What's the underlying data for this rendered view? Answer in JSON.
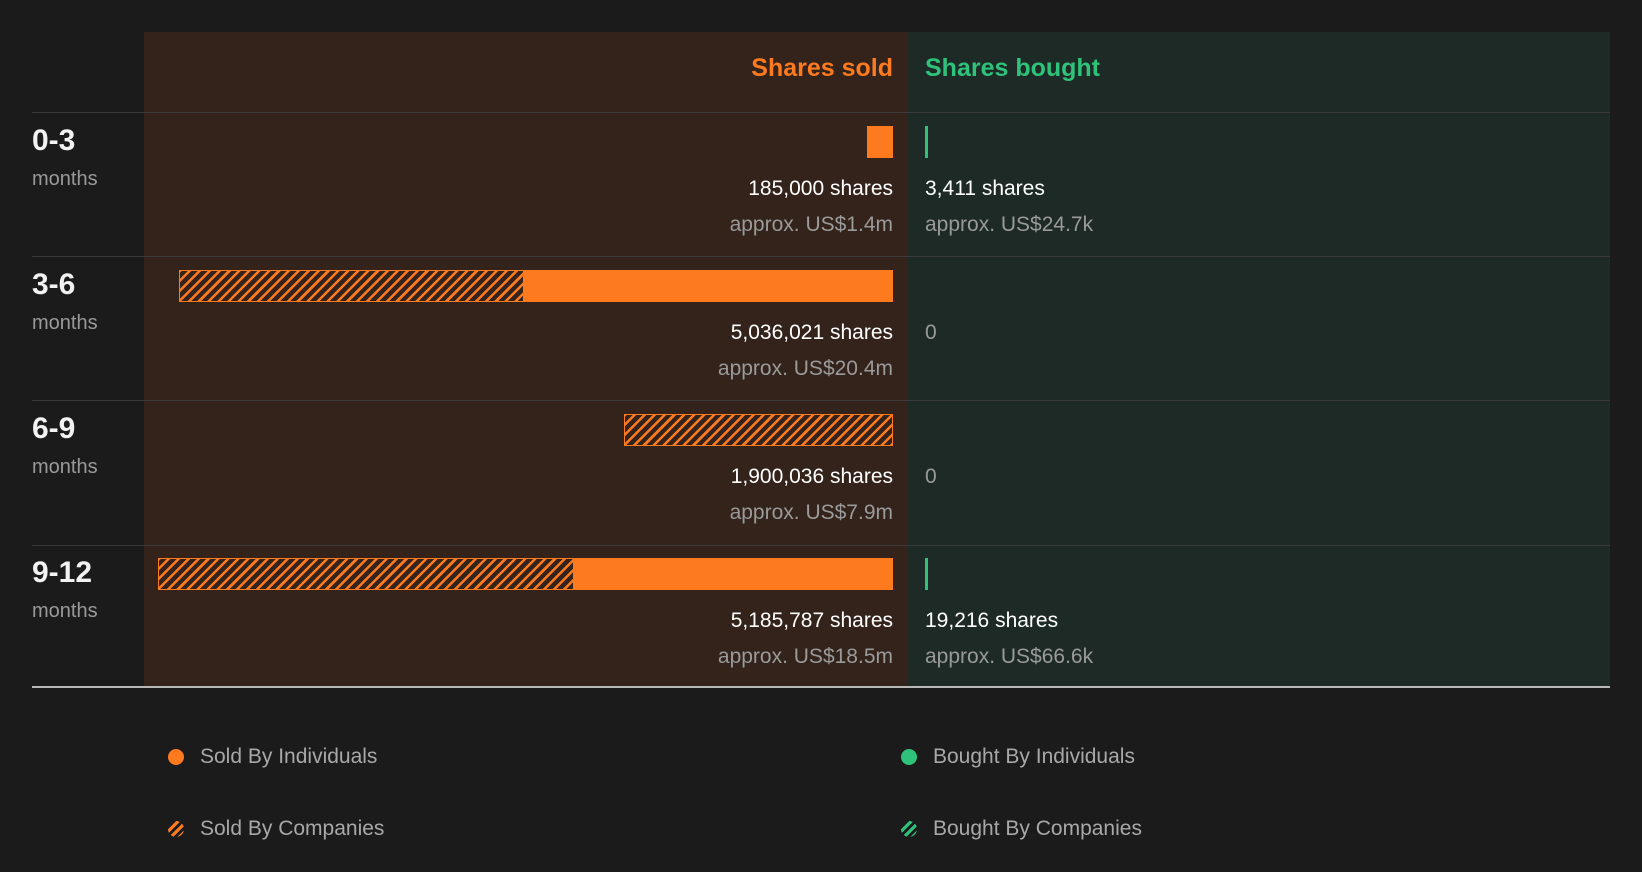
{
  "header": {
    "sold": "Shares sold",
    "bought": "Shares bought"
  },
  "colors": {
    "sold": "#fd7a1f",
    "bought": "#2fc27a",
    "sold_panel": "#33231b",
    "bought_panel": "#1d2a25",
    "background": "#1b1b1b"
  },
  "rows": [
    {
      "range": "0-3",
      "unit": "months",
      "sold_shares": "185,000 shares",
      "sold_approx": "approx. US$1.4m",
      "bought_shares": "3,411 shares",
      "bought_approx": "approx. US$24.7k"
    },
    {
      "range": "3-6",
      "unit": "months",
      "sold_shares": "5,036,021 shares",
      "sold_approx": "approx. US$20.4m",
      "bought_shares": "0",
      "bought_approx": ""
    },
    {
      "range": "6-9",
      "unit": "months",
      "sold_shares": "1,900,036 shares",
      "sold_approx": "approx. US$7.9m",
      "bought_shares": "0",
      "bought_approx": ""
    },
    {
      "range": "9-12",
      "unit": "months",
      "sold_shares": "5,185,787 shares",
      "sold_approx": "approx. US$18.5m",
      "bought_shares": "19,216 shares",
      "bought_approx": "approx. US$66.6k"
    }
  ],
  "legend": {
    "sold_individuals": "Sold By Individuals",
    "sold_companies": "Sold By Companies",
    "bought_individuals": "Bought By Individuals",
    "bought_companies": "Bought By Companies"
  },
  "chart_data": {
    "type": "bar",
    "categories": [
      "0-3",
      "3-6",
      "6-9",
      "9-12"
    ],
    "series": [
      {
        "name": "Sold By Individuals",
        "values": [
          185000,
          2600000,
          0,
          2250000
        ]
      },
      {
        "name": "Sold By Companies",
        "values": [
          0,
          2436021,
          1900036,
          2935787
        ]
      },
      {
        "name": "Bought By Individuals",
        "values": [
          3411,
          0,
          0,
          19216
        ]
      },
      {
        "name": "Bought By Companies",
        "values": [
          0,
          0,
          0,
          0
        ]
      }
    ],
    "xlabel": "",
    "ylabel": "",
    "grid": false,
    "legend_position": "bottom"
  }
}
